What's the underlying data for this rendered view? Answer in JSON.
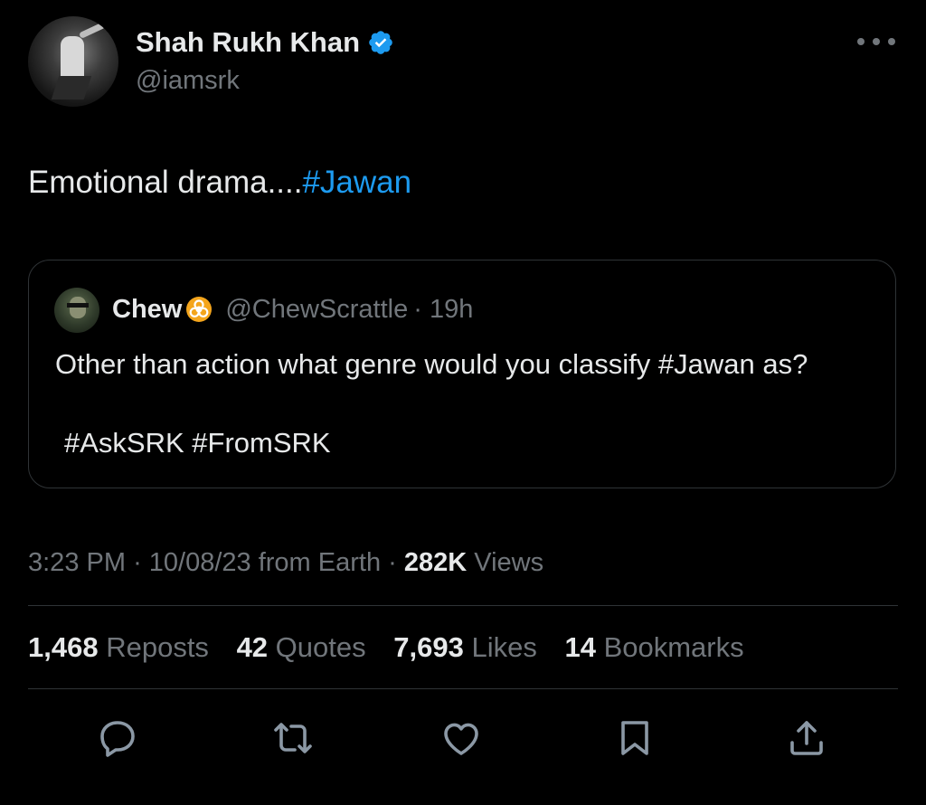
{
  "author": {
    "name": "Shah Rukh Khan",
    "handle": "@iamsrk",
    "verified": true,
    "verified_color": "#1d9bf0"
  },
  "tweet": {
    "text_plain": "Emotional drama....",
    "hashtag": "#Jawan"
  },
  "quoted": {
    "name": "Chew",
    "emoji": "biohazard-emoji",
    "handle": "@ChewScrattle",
    "time": "· 19h",
    "text": "Other than action what genre would you classify #Jawan as?",
    "tags": "#AskSRK #FromSRK"
  },
  "meta": {
    "time": "3:23 PM",
    "date": "· 10/08/23 from Earth ·",
    "views_count": "282K",
    "views_label": "Views"
  },
  "stats": {
    "reposts_count": "1,468",
    "reposts_label": "Reposts",
    "quotes_count": "42",
    "quotes_label": "Quotes",
    "likes_count": "7,693",
    "likes_label": "Likes",
    "bookmarks_count": "14",
    "bookmarks_label": "Bookmarks"
  },
  "actions": [
    "reply-icon",
    "repost-icon",
    "like-icon",
    "bookmark-icon",
    "share-icon"
  ],
  "colors": {
    "background": "#000000",
    "text": "#e7e9ea",
    "muted": "#71767b",
    "accent": "#1d9bf0",
    "border": "#2f3336"
  }
}
